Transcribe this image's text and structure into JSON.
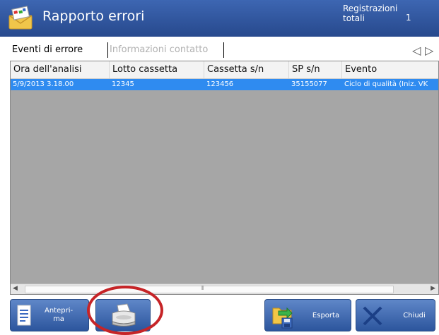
{
  "header": {
    "title": "Rapporto errori",
    "registrations_label": "Registrazioni totali",
    "registrations_count": "1",
    "icon": "envelope-report-icon"
  },
  "tabs": [
    {
      "label": "Eventi di errore",
      "active": true
    },
    {
      "label": "Informazioni contatto",
      "active": false
    }
  ],
  "grid": {
    "columns": [
      "Ora dell'analisi",
      "Lotto cassetta",
      "Cassetta s/n",
      "SP s/n",
      "Evento"
    ],
    "rows": [
      [
        "5/9/2013 3.18.00",
        "12345",
        "123456",
        "35155077",
        "Ciclo di qualità (Iniz. VK"
      ]
    ]
  },
  "buttons": {
    "preview": {
      "label": "Antepri-\nma",
      "icon": "document-preview-icon"
    },
    "print": {
      "label": "",
      "icon": "printer-icon"
    },
    "export": {
      "label": "Esporta",
      "icon": "export-folder-icon"
    },
    "close": {
      "label": "Chiudi",
      "icon": "close-x-icon"
    }
  },
  "colors": {
    "header": "#2f56a0",
    "selected_row": "#2f8bf0",
    "grid_background": "#a6a6a6",
    "annotation_circle": "#c62427"
  }
}
